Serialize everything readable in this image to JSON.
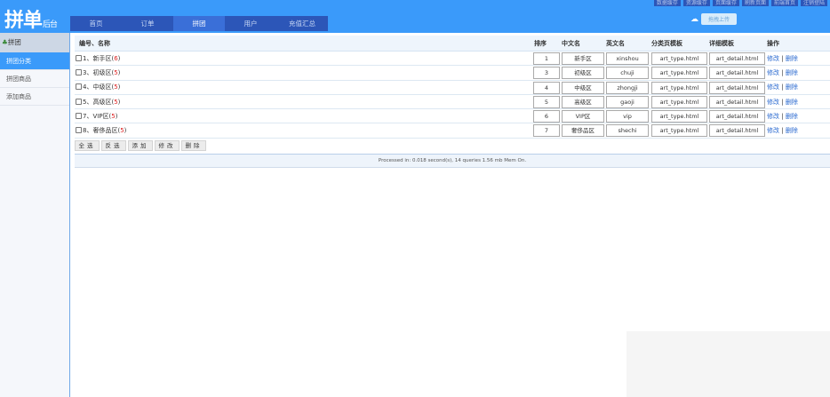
{
  "header": {
    "logo": "拼单",
    "logo_sub": "后台",
    "nav": [
      {
        "label": "首页"
      },
      {
        "label": "订单"
      },
      {
        "label": "拼团",
        "active": true
      },
      {
        "label": "用户"
      },
      {
        "label": "充值汇总"
      }
    ],
    "tools": [
      "数据缓存",
      "资源缓存",
      "页面缓存",
      "刷新页面",
      "前端首页",
      "注销登陆"
    ],
    "upload_label": "拖拽上传"
  },
  "sidebar": {
    "title": "拼团",
    "items": [
      {
        "label": "拼团分类",
        "active": true
      },
      {
        "label": "拼团商品"
      },
      {
        "label": "添加商品"
      }
    ]
  },
  "table": {
    "headers": {
      "name": "编号、名称",
      "order": "排序",
      "cn": "中文名",
      "en": "英文名",
      "type_tpl": "分类页模板",
      "detail_tpl": "详细模板",
      "ops": "操作"
    },
    "rows": [
      {
        "id": "1",
        "name": "新手区",
        "count": "6",
        "order": "1",
        "cn": "新手区",
        "en": "xinshou",
        "type_tpl": "art_type.html",
        "detail_tpl": "art_detail.html"
      },
      {
        "id": "3",
        "name": "初级区",
        "count": "5",
        "order": "3",
        "cn": "初级区",
        "en": "chuji",
        "type_tpl": "art_type.html",
        "detail_tpl": "art_detail.html"
      },
      {
        "id": "4",
        "name": "中级区",
        "count": "5",
        "order": "4",
        "cn": "中级区",
        "en": "zhongji",
        "type_tpl": "art_type.html",
        "detail_tpl": "art_detail.html"
      },
      {
        "id": "5",
        "name": "高级区",
        "count": "5",
        "order": "5",
        "cn": "高级区",
        "en": "gaoji",
        "type_tpl": "art_type.html",
        "detail_tpl": "art_detail.html"
      },
      {
        "id": "7",
        "name": "VIP区",
        "count": "5",
        "order": "6",
        "cn": "VIP区",
        "en": "vip",
        "type_tpl": "art_type.html",
        "detail_tpl": "art_detail.html"
      },
      {
        "id": "8",
        "name": "奢侈品区",
        "count": "5",
        "order": "7",
        "cn": "奢侈品区",
        "en": "shechi",
        "type_tpl": "art_type.html",
        "detail_tpl": "art_detail.html"
      }
    ],
    "edit_label": "修改",
    "delete_label": "删除",
    "sep": "|"
  },
  "actions": [
    "全选",
    "反选",
    "添加",
    "修改",
    "删除"
  ],
  "footer": "Processed in: 0.018 second(s), 14 queries 1.56 mb Mem On."
}
